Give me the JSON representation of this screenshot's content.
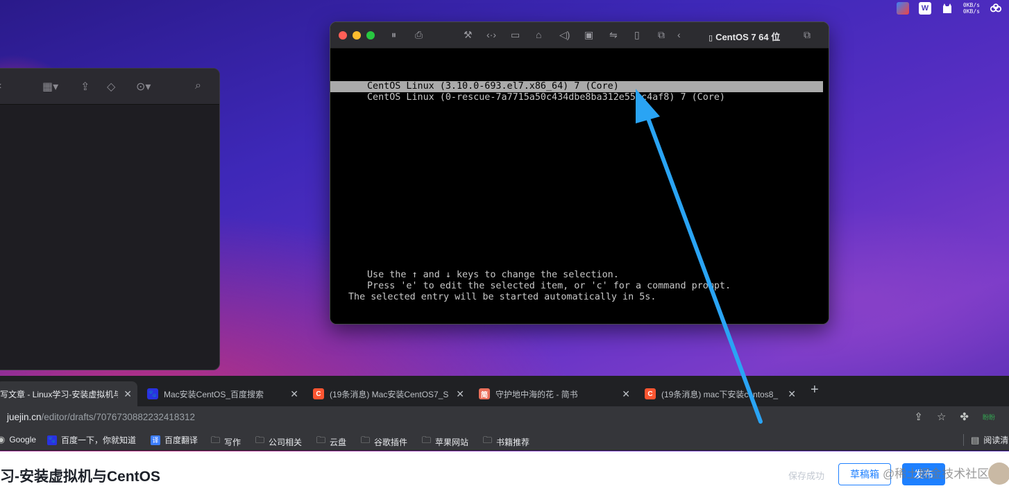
{
  "menubar": {
    "net_up": "0KB/s",
    "net_down": "0KB/s",
    "icons": [
      "screen-mirror-icon",
      "wps-icon",
      "cat-icon",
      "network-speed-icon",
      "cloud-icon"
    ],
    "wps_glyph": "W"
  },
  "vm_window": {
    "title": "CentOS 7 64 位",
    "grub": {
      "entries": [
        "CentOS Linux (3.10.0-693.el7.x86_64) 7 (Core)",
        "CentOS Linux (0-rescue-7a7715a50c434dbe8ba312e55ec4af8) 7 (Core)"
      ],
      "selected_index": 0,
      "help_line1": "Use the ↑ and ↓ keys to change the selection.",
      "help_line2": "Press 'e' to edit the selected item, or 'c' for a command prompt.",
      "help_line3": "The selected entry will be started automatically in 5s."
    }
  },
  "browser": {
    "tabs": [
      {
        "title": "写文章 - Linux学习-安装虚拟机与",
        "favicon_color": "#1e80ff",
        "active": true
      },
      {
        "title": "Mac安装CentOS_百度搜索",
        "favicon_color": "#2932e1",
        "favicon_glyph": "du",
        "active": false
      },
      {
        "title": "(19条消息) Mac安装CentOS7_S",
        "favicon_color": "#fc5531",
        "favicon_glyph": "C",
        "active": false
      },
      {
        "title": "守护地中海的花 - 简书",
        "favicon_color": "#ea6f5a",
        "favicon_glyph": "简",
        "active": false
      },
      {
        "title": "(19条消息) mac下安装centos8_",
        "favicon_color": "#fc5531",
        "favicon_glyph": "C",
        "active": false
      }
    ],
    "close_glyph": "✕",
    "newtab_glyph": "+",
    "url_host": "juejin.cn",
    "url_path": "/editor/drafts/7076730882232418312",
    "ext_badge": "盼盼",
    "bookmarks": [
      {
        "label": "Google",
        "icon": "globe"
      },
      {
        "label": "百度一下，你就知道",
        "icon": "baidu"
      },
      {
        "label": "百度翻译",
        "icon": "translate"
      },
      {
        "label": "写作",
        "icon": "folder"
      },
      {
        "label": "公司相关",
        "icon": "folder"
      },
      {
        "label": "云盘",
        "icon": "folder"
      },
      {
        "label": "谷歌插件",
        "icon": "folder"
      },
      {
        "label": "苹果网站",
        "icon": "folder"
      },
      {
        "label": "书籍推荐",
        "icon": "folder"
      }
    ],
    "reading_list": "阅读清"
  },
  "editor": {
    "title": "习-安装虚拟机与CentOS",
    "saved_status": "保存成功",
    "draft_button": "草稿箱",
    "publish_button": "发布",
    "watermark": "@稀土掘金技术社区"
  },
  "colors": {
    "accent": "#1e80ff",
    "arrow": "#2aa4f4",
    "grub_highlight": "#aaaaaa"
  }
}
